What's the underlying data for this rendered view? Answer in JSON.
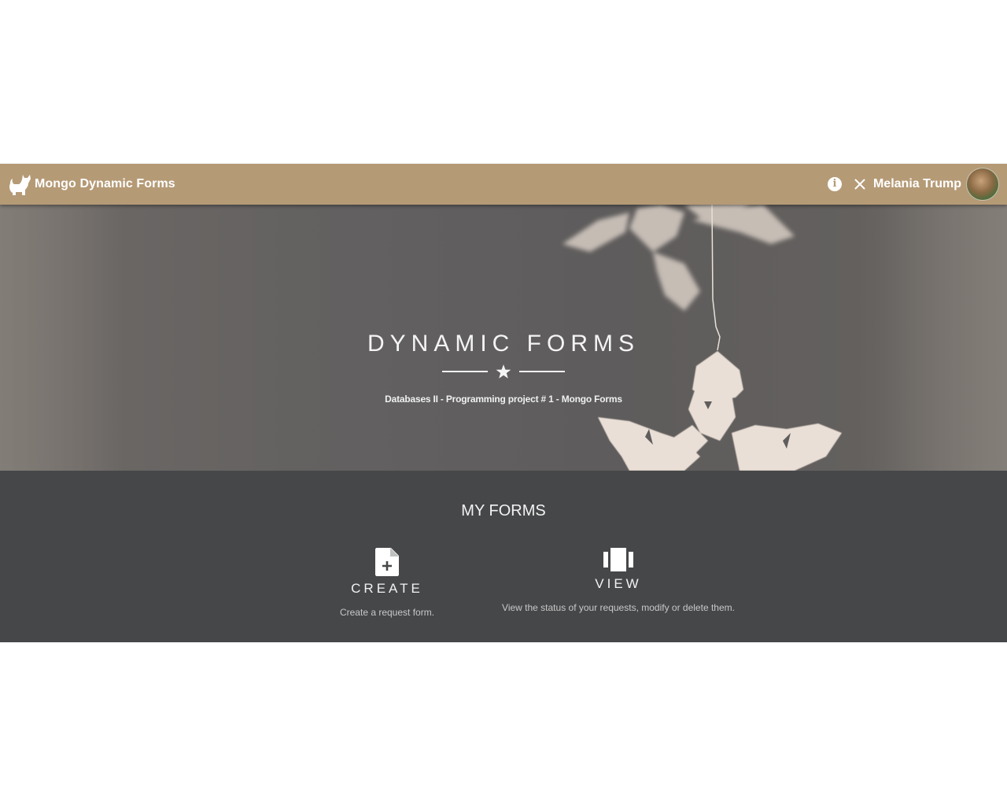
{
  "navbar": {
    "brand_title": "Mongo Dynamic Forms",
    "logo_icon": "cat-icon",
    "info_icon": "info-icon",
    "info_glyph": "i",
    "close_icon": "close-icon",
    "user_name": "Melania Trump",
    "avatar": "user-avatar",
    "background_color": "#b59a76"
  },
  "hero": {
    "title": "DYNAMIC FORMS",
    "divider_icon": "star-icon",
    "subtitle": "Databases II - Programming project # 1 - Mongo Forms",
    "background_image": "paper-snowflake-ornaments"
  },
  "forms_section": {
    "title": "MY FORMS",
    "background_color": "#464749",
    "cards": [
      {
        "icon": "file-add-icon",
        "title": "CREATE",
        "description": "Create a request form."
      },
      {
        "icon": "view-carousel-icon",
        "title": "VIEW",
        "description": "View the status of your requests, modify or delete them."
      }
    ]
  }
}
